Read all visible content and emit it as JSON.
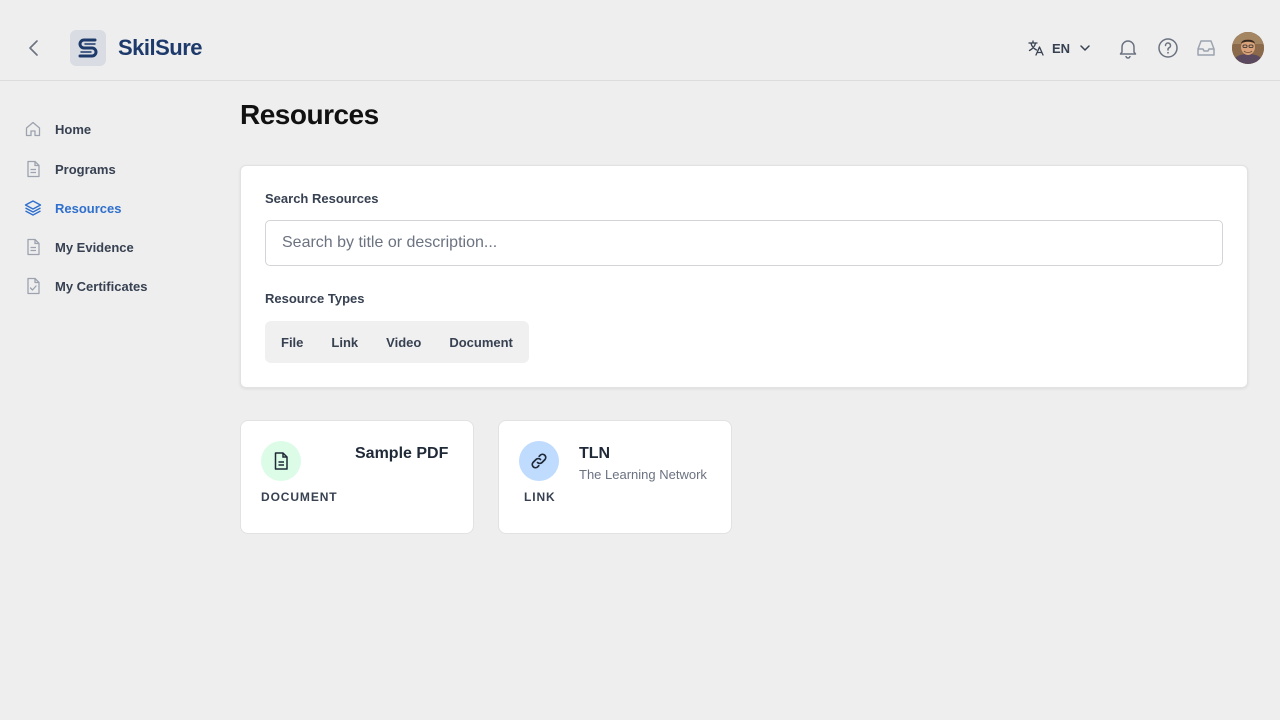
{
  "header": {
    "brand": "SkilSure",
    "language": "EN"
  },
  "sidebar": {
    "items": [
      {
        "label": "Home",
        "icon": "home-icon"
      },
      {
        "label": "Programs",
        "icon": "document-icon"
      },
      {
        "label": "Resources",
        "icon": "layers-icon",
        "active": true
      },
      {
        "label": "My Evidence",
        "icon": "document-icon"
      },
      {
        "label": "My Certificates",
        "icon": "document-check-icon"
      }
    ]
  },
  "main": {
    "title": "Resources",
    "search": {
      "label": "Search Resources",
      "placeholder": "Search by title or description...",
      "value": ""
    },
    "types": {
      "label": "Resource Types",
      "options": [
        "File",
        "Link",
        "Video",
        "Document"
      ]
    },
    "cards": [
      {
        "title": "Sample PDF",
        "type": "DOCUMENT",
        "description": "",
        "icon": "document-icon",
        "color": "#dcfce7"
      },
      {
        "title": "TLN",
        "type": "LINK",
        "description": "The Learning Network",
        "icon": "link-icon",
        "color": "#bfdbfe"
      }
    ]
  },
  "colors": {
    "accent": "#2f6fcd",
    "brand": "#1d3a6b",
    "background": "#eeeeee"
  }
}
